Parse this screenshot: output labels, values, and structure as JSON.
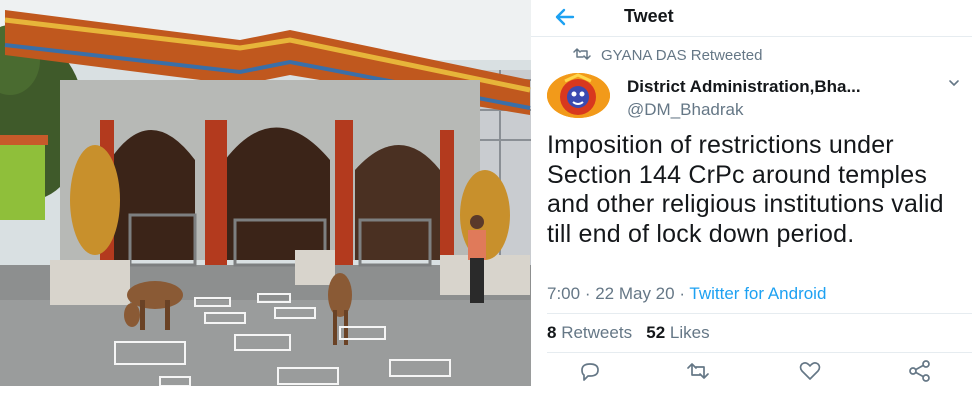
{
  "header": {
    "back_icon": "arrow-left-icon",
    "title": "Tweet"
  },
  "retweet_context": {
    "icon": "retweet-icon",
    "text": "GYANA DAS Retweeted"
  },
  "author": {
    "display_name": "District Administration,Bha...",
    "handle": "@DM_Bhadrak",
    "menu_icon": "chevron-down-icon"
  },
  "tweet": {
    "text": "Imposition of restrictions under Section 144 CrPc around temples and other religious institutions valid till end of lock down period.",
    "time": "7:00",
    "separator": " · ",
    "date": "22 May 20",
    "source": "Twitter for Android"
  },
  "stats": {
    "retweets_count": "8",
    "retweets_label": "Retweets",
    "likes_count": "52",
    "likes_label": "Likes"
  },
  "actions": [
    "reply-icon",
    "retweet-icon",
    "like-icon",
    "share-icon"
  ],
  "colors": {
    "accent": "#1da1f2",
    "text": "#14171a",
    "muted": "#657786"
  }
}
